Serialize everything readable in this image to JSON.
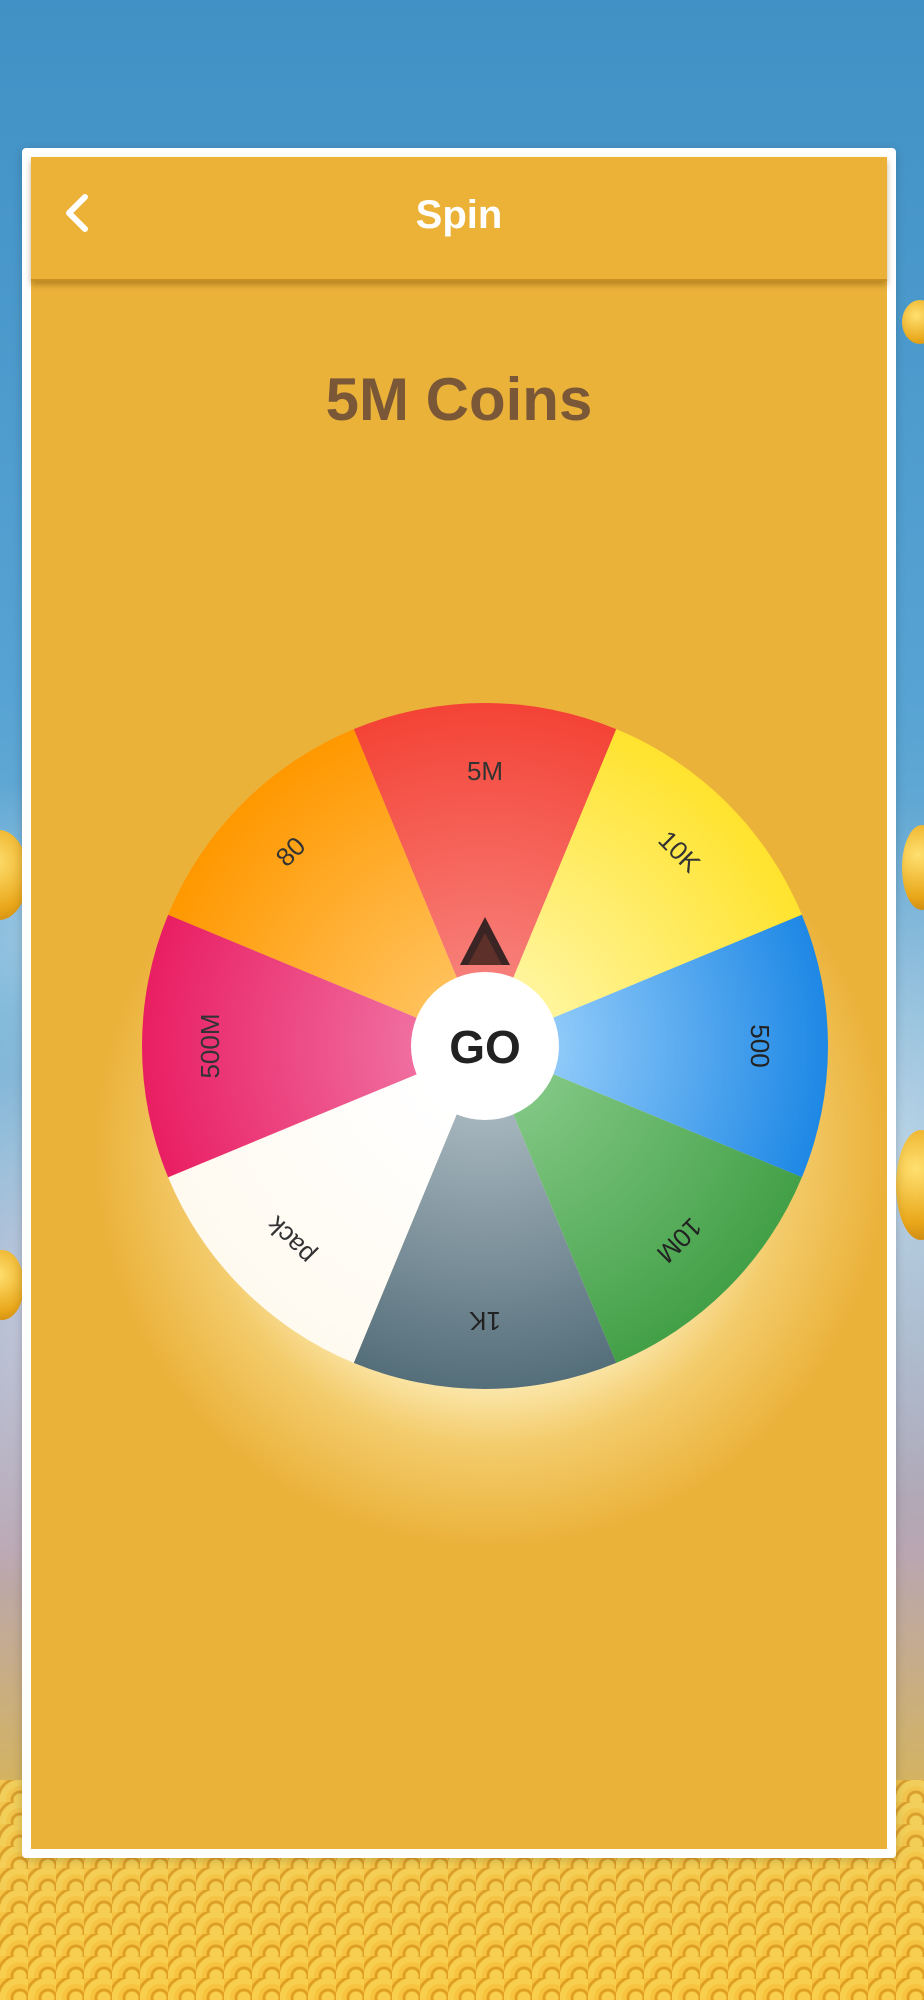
{
  "header": {
    "title": "Spin",
    "back_icon": "chevron-left-icon"
  },
  "prize": {
    "label": "5M Coins"
  },
  "wheel": {
    "go_label": "GO",
    "pointer_icon": "pointer-triangle-icon",
    "segments": [
      {
        "label": "5M",
        "color_outer": "#f44336",
        "color_inner": "#f7807a",
        "text_color": "#333333"
      },
      {
        "label": "10K",
        "color_outer": "#ffe32e",
        "color_inner": "#fff59d",
        "text_color": "#333333"
      },
      {
        "label": "500",
        "color_outer": "#1e88e5",
        "color_inner": "#90caf9",
        "text_color": "#222222"
      },
      {
        "label": "10M",
        "color_outer": "#43a047",
        "color_inner": "#81c784",
        "text_color": "#222222"
      },
      {
        "label": "1K",
        "color_outer": "#546e7a",
        "color_inner": "#a7b6be",
        "text_color": "#222222"
      },
      {
        "label": "pack",
        "color_outer": "#fffaf0",
        "color_inner": "#ffffff",
        "text_color": "#333333"
      },
      {
        "label": "500M",
        "color_outer": "#e91e63",
        "color_inner": "#f06fa0",
        "text_color": "#333333"
      },
      {
        "label": "80",
        "color_outer": "#ff9800",
        "color_inner": "#ffc15a",
        "text_color": "#333333"
      }
    ]
  },
  "colors": {
    "panel": "#ebb23a",
    "prize_text": "#7a5837",
    "header_text": "#ffffff"
  }
}
